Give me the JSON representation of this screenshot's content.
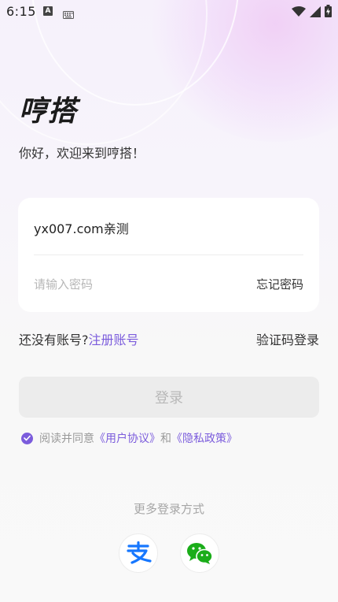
{
  "status_bar": {
    "time": "6:15",
    "a_indicator": "A",
    "icons": [
      "keyboard-icon",
      "wifi-icon",
      "signal-icon",
      "battery-charging-icon"
    ]
  },
  "app": {
    "logo_text": "哼搭",
    "welcome": "你好，欢迎来到哼搭！"
  },
  "form": {
    "account_value": "yx007.com亲测",
    "password_placeholder": "请输入密码",
    "forgot_password": "忘记密码"
  },
  "links": {
    "no_account": "还没有账号?",
    "register": "注册账号",
    "code_login": "验证码登录"
  },
  "login_button": "登录",
  "agreement": {
    "checked": true,
    "prefix": "阅读并同意",
    "user_agreement": "《用户协议》",
    "and": "和",
    "privacy_policy": "《隐私政策》"
  },
  "other_login": {
    "title": "更多登录方式",
    "methods": [
      "alipay-icon",
      "wechat-icon"
    ]
  },
  "colors": {
    "accent": "#7b5cdc",
    "alipay": "#1677ff",
    "wechat": "#1aad19"
  }
}
